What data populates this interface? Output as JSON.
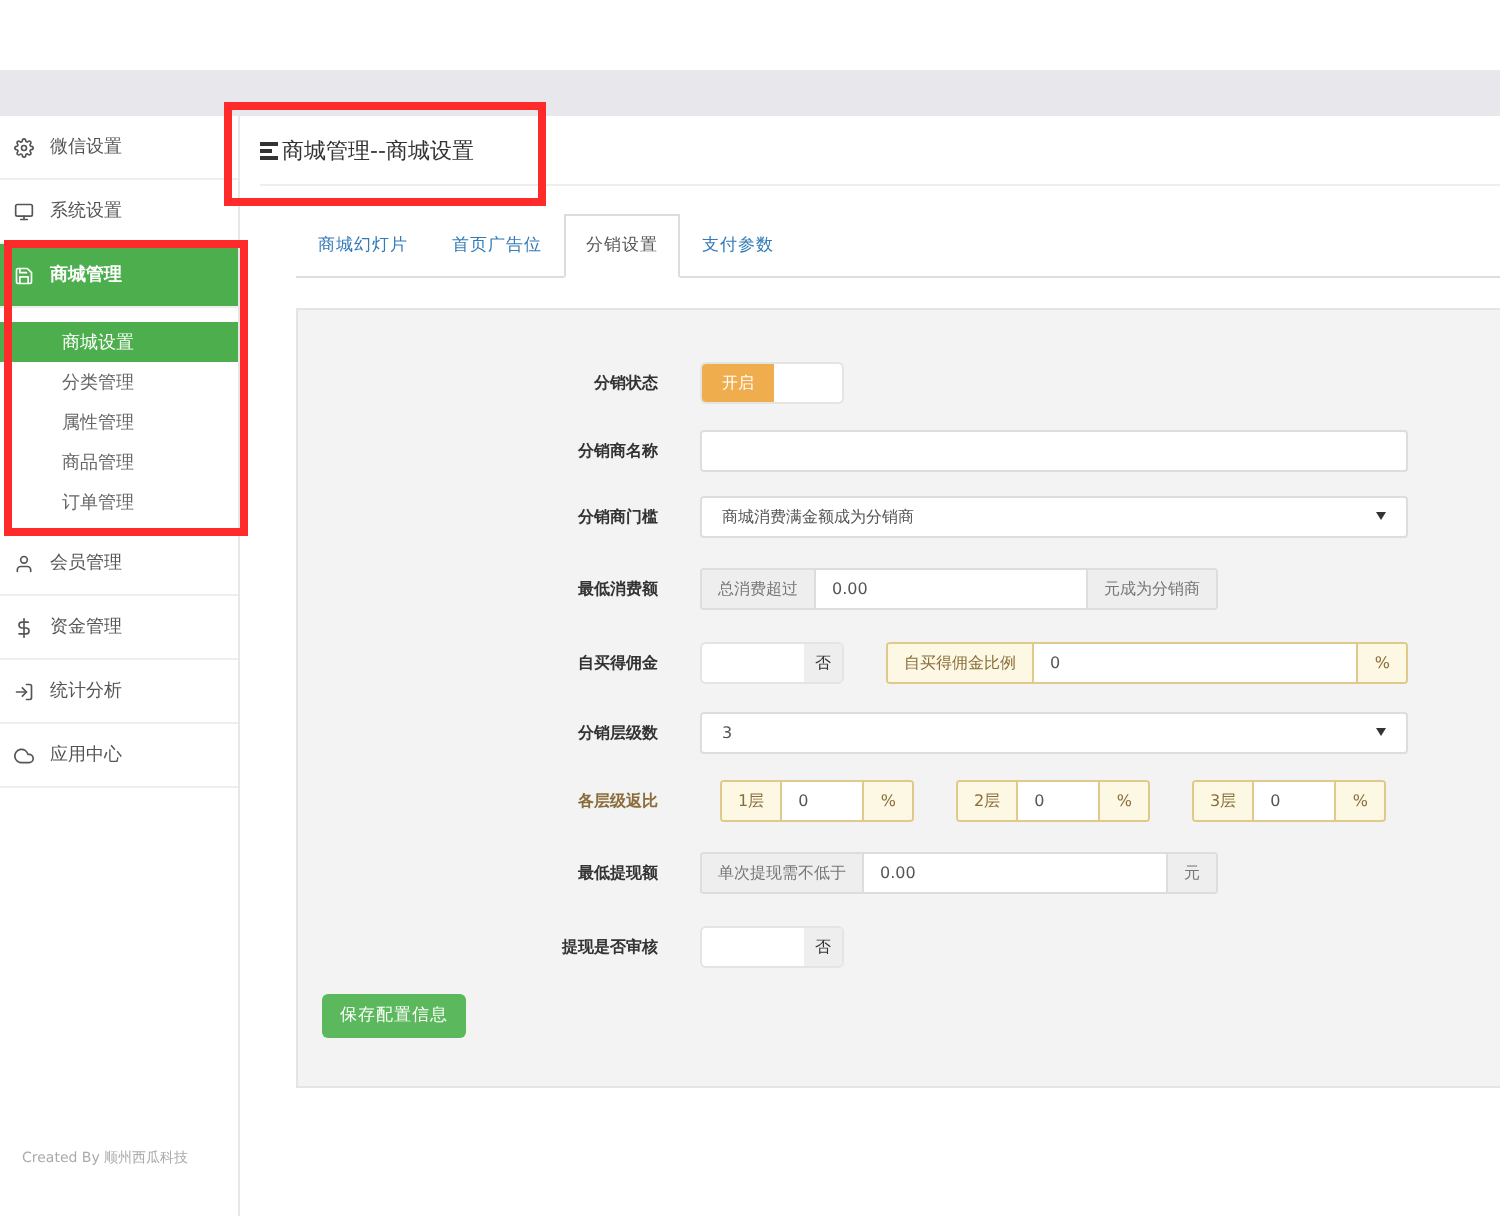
{
  "header": {
    "title": "商城管理--商城设置",
    "highlighted": true
  },
  "sidebar": {
    "items": [
      {
        "label": "微信设置",
        "selected": false
      },
      {
        "label": "系统设置",
        "selected": false
      },
      {
        "label": "商城管理",
        "selected": true,
        "expanded": true,
        "highlighted": true,
        "children": [
          {
            "label": "商城设置",
            "selected": true
          },
          {
            "label": "分类管理",
            "selected": false
          },
          {
            "label": "属性管理",
            "selected": false
          },
          {
            "label": "商品管理",
            "selected": false
          },
          {
            "label": "订单管理",
            "selected": false
          }
        ]
      },
      {
        "label": "会员管理",
        "selected": false
      },
      {
        "label": "资金管理",
        "selected": false
      },
      {
        "label": "统计分析",
        "selected": false
      },
      {
        "label": "应用中心",
        "selected": false
      }
    ],
    "footer": "Created By 顺州西瓜科技"
  },
  "tabs": [
    {
      "label": "商城幻灯片",
      "selected": false
    },
    {
      "label": "首页广告位",
      "selected": false
    },
    {
      "label": "分销设置",
      "selected": true
    },
    {
      "label": "支付参数",
      "selected": false
    }
  ],
  "form": {
    "rows": [
      {
        "kind": "switch",
        "label": "分销状态",
        "on": true,
        "text": "开启"
      },
      {
        "kind": "input",
        "label": "分销商名称"
      },
      {
        "kind": "select",
        "label": "分销商门槛",
        "value": "商城消费满金额成为分销商"
      },
      {
        "kind": "addon",
        "label": "最低消费额",
        "prefix": "总消费超过",
        "value": "0.00",
        "suffix": "元成为分销商"
      },
      {
        "kind": "switch",
        "label": "自买得佣金",
        "on": false,
        "text": "否",
        "extra": {
          "prefix": "自买得佣金比例",
          "value": "0",
          "suffix": "%"
        }
      },
      {
        "kind": "select",
        "label": "分销层级数",
        "value": "3"
      },
      {
        "kind": "levels",
        "label": "各层级返比",
        "levels": [
          {
            "prefix": "1层",
            "value": "0",
            "suffix": "%"
          },
          {
            "prefix": "2层",
            "value": "0",
            "suffix": "%"
          },
          {
            "prefix": "3层",
            "value": "0",
            "suffix": "%"
          }
        ]
      },
      {
        "kind": "addon",
        "label": "最低提现额",
        "prefix": "单次提现需不低于",
        "value": "0.00",
        "suffix": "元"
      },
      {
        "kind": "switch",
        "label": "提现是否审核",
        "on": false,
        "text": "否"
      }
    ],
    "save_button": "保存配置信息"
  }
}
